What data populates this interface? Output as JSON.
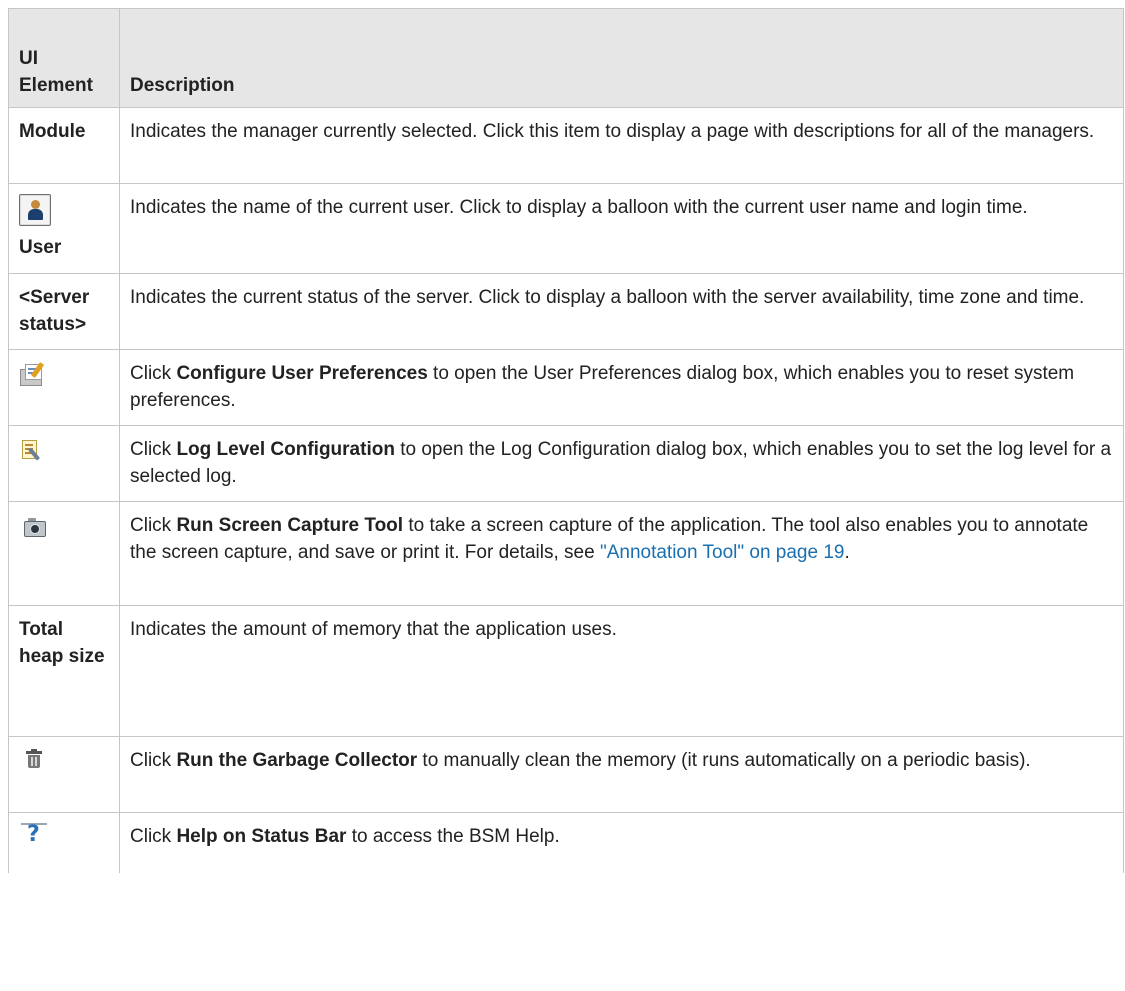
{
  "header": {
    "col1": "UI Element",
    "col2": "Description"
  },
  "rows": [
    {
      "element": "Module",
      "description": "Indicates the manager currently selected. Click this item to display a page with descriptions for all of the managers."
    },
    {
      "element": "User",
      "icon": "user-icon",
      "description": "Indicates the name of the current user. Click to display a balloon with the current user name and login time."
    },
    {
      "element": "<Server status>",
      "description": "Indicates the current status of the server. Click to display a balloon with the server availability, time zone and time."
    },
    {
      "icon": "configure-user-preferences-icon",
      "pre": "Click ",
      "bold": "Configure User Preferences",
      "post": " to open the User Preferences dialog box, which enables you to reset system preferences."
    },
    {
      "icon": "log-level-configuration-icon",
      "pre": "Click ",
      "bold": "Log Level Configuration",
      "post": " to open the Log Configuration dialog box, which enables you to set the log level for a selected log."
    },
    {
      "icon": "screen-capture-camera-icon",
      "pre": "Click ",
      "bold": "Run Screen Capture Tool",
      "post": " to take a screen capture of the application. The tool also enables you to annotate the screen capture, and save or print it. For details, see ",
      "link": "\"Annotation Tool\" on page 19",
      "tail": "."
    },
    {
      "element": "Total heap size",
      "description": "Indicates the amount of memory that the application uses."
    },
    {
      "icon": "trash-icon",
      "pre": "Click ",
      "bold": "Run the Garbage Collector",
      "post": " to manually clean the memory (it runs automatically on a periodic basis)."
    },
    {
      "icon": "help-icon",
      "pre": "Click ",
      "bold": "Help on Status Bar",
      "post": " to access the BSM Help."
    }
  ],
  "colors": {
    "header_bg": "#e6e6e6",
    "border": "#c6c6c6",
    "link": "#1a6fb0"
  }
}
